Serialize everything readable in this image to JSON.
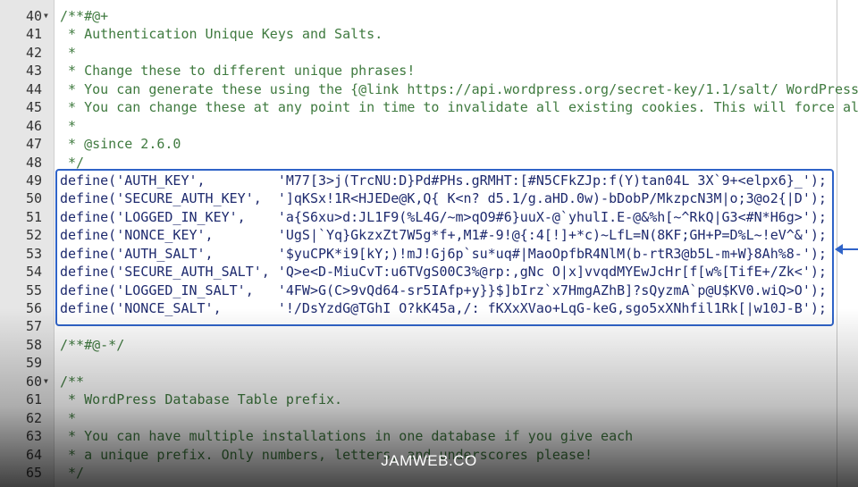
{
  "editor": {
    "lines": [
      {
        "n": "40",
        "fold": true,
        "type": "comment",
        "text": "/**#@+"
      },
      {
        "n": "41",
        "type": "comment",
        "text": " * Authentication Unique Keys and Salts."
      },
      {
        "n": "42",
        "type": "comment",
        "text": " *"
      },
      {
        "n": "43",
        "type": "comment",
        "text": " * Change these to different unique phrases!"
      },
      {
        "n": "44",
        "type": "comment",
        "text": " * You can generate these using the {@link https://api.wordpress.org/secret-key/1.1/salt/ WordPress"
      },
      {
        "n": "45",
        "type": "comment",
        "text": " * You can change these at any point in time to invalidate all existing cookies. This will force al"
      },
      {
        "n": "46",
        "type": "comment",
        "text": " *"
      },
      {
        "n": "47",
        "type": "comment",
        "text": " * @since 2.6.0"
      },
      {
        "n": "48",
        "type": "comment",
        "text": " */"
      },
      {
        "n": "49",
        "type": "def",
        "text": "define('AUTH_KEY',         'M77[3>j(TrcNU:D}Pd#PHs.gRMHT:[#N5CFkZJp:f(Y)tan04L 3X`9+<elpx6}_');"
      },
      {
        "n": "50",
        "type": "def",
        "text": "define('SECURE_AUTH_KEY',  ']qKSx!1R<HJEDe@K,Q{ K<n? d5.1/g.aHD.0w)-bDobP/MkzpcN3M|o;3@o2{|D');"
      },
      {
        "n": "51",
        "type": "def",
        "text": "define('LOGGED_IN_KEY',    'a{S6xu>d:JL1F9(%L4G/~m>qO9#6}uuX-@`yhulI.E-@&%h[~^RkQ|G3<#N*H6g>');"
      },
      {
        "n": "52",
        "type": "def",
        "text": "define('NONCE_KEY',        'UgS|`Yq}GkzxZt7W5g*f+,M1#-9!@{:4[!]+*c)~LfL=N(8KF;GH+P=D%L~!eV^&');"
      },
      {
        "n": "53",
        "type": "def",
        "text": "define('AUTH_SALT',        '$yuCPK*i9[kY;)!mJ!Gj6p`su*uq#|MaoOpfbR4NlM(b-rtR3@b5L-m+W}8Ah%8-');"
      },
      {
        "n": "54",
        "type": "def",
        "text": "define('SECURE_AUTH_SALT', 'Q>e<D-MiuCvT:u6TVgS00C3%@rp:,gNc O|x]vvqdMYEwJcHr[f[w%[TifE+/Zk<');"
      },
      {
        "n": "55",
        "type": "def",
        "text": "define('LOGGED_IN_SALT',   '4FW>G(C>9vQd64-sr5IAfp+y}}$]bIrz`x7HmgAZhB]?sQyzmA`p@U$KV0.wiQ>O');"
      },
      {
        "n": "56",
        "type": "def",
        "text": "define('NONCE_SALT',       '!/DsYzdG@TGhI O?kK45a,/: fKXxXVao+LqG-keG,sgo5xXNhfil1Rk[|w10J-B');"
      },
      {
        "n": "57",
        "type": "plain",
        "text": ""
      },
      {
        "n": "58",
        "type": "comment",
        "text": "/**#@-*/"
      },
      {
        "n": "59",
        "type": "plain",
        "text": ""
      },
      {
        "n": "60",
        "fold": true,
        "type": "comment",
        "text": "/**"
      },
      {
        "n": "61",
        "type": "comment",
        "text": " * WordPress Database Table prefix."
      },
      {
        "n": "62",
        "type": "comment",
        "text": " *"
      },
      {
        "n": "63",
        "type": "comment",
        "text": " * You can have multiple installations in one database if you give each"
      },
      {
        "n": "64",
        "type": "comment",
        "text": " * a unique prefix. Only numbers, letters, and underscores please!"
      },
      {
        "n": "65",
        "type": "comment",
        "text": " */"
      }
    ],
    "highlight_color": "#2f63c8"
  },
  "watermark": "JAMWEB.CO"
}
